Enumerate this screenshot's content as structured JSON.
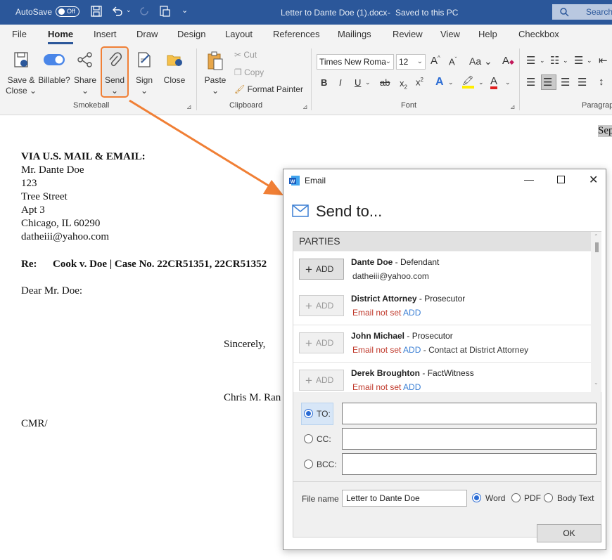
{
  "titlebar": {
    "autosave_label": "AutoSave",
    "autosave_state": "Off",
    "document_title": "Letter to Dante Doe (1).docx",
    "save_status": "Saved to this PC",
    "search_label": "Search"
  },
  "tabs": [
    "File",
    "Home",
    "Insert",
    "Draw",
    "Design",
    "Layout",
    "References",
    "Mailings",
    "Review",
    "View",
    "Help",
    "Checkbox"
  ],
  "ribbon": {
    "smokeball": {
      "group_label": "Smokeball",
      "save_close": [
        "Save &",
        "Close"
      ],
      "billable": "Billable?",
      "share": "Share",
      "send": "Send",
      "sign": "Sign",
      "close": "Close"
    },
    "clipboard": {
      "group_label": "Clipboard",
      "paste": "Paste",
      "cut": "Cut",
      "copy": "Copy",
      "format_painter": "Format Painter"
    },
    "font": {
      "group_label": "Font",
      "font_name": "Times New Roma",
      "font_size": "12"
    },
    "paragraph": {
      "group_label": "Paragrap"
    }
  },
  "document": {
    "date_fragment": "Sep",
    "lines": [
      "VIA U.S. MAIL & EMAIL:",
      "Mr. Dante Doe",
      "123",
      "Tree Street",
      "Apt 3",
      "Chicago, IL 60290",
      "datheiii@yahoo.com"
    ],
    "re_label": "Re:",
    "re_text": "Cook v. Doe | Case No. 22CR51351, 22CR51352",
    "salutation": "Dear Mr. Doe:",
    "closing": "Sincerely,",
    "signer": "Chris M. Ran",
    "initials": "CMR/"
  },
  "dialog": {
    "window_title": "Email",
    "heading": "Send to...",
    "parties_header": "PARTIES",
    "add_label": "ADD",
    "parties": [
      {
        "name": "Dante Doe",
        "role": "Defendant",
        "email": "datheiii@yahoo.com",
        "email_missing": false,
        "add_link": "",
        "contact": ""
      },
      {
        "name": "District Attorney",
        "role": "Prosecutor",
        "email": "Email not set",
        "email_missing": true,
        "add_link": "ADD",
        "contact": ""
      },
      {
        "name": "John Michael",
        "role": "Prosecutor",
        "email": "Email not set",
        "email_missing": true,
        "add_link": "ADD",
        "contact": "Contact at District Attorney"
      },
      {
        "name": "Derek Broughton",
        "role": "FactWitness",
        "email": "Email not set",
        "email_missing": true,
        "add_link": "ADD",
        "contact": ""
      }
    ],
    "recipients": {
      "to_label": "TO:",
      "cc_label": "CC:",
      "bcc_label": "BCC:",
      "selected": "TO",
      "to_value": "",
      "cc_value": "",
      "bcc_value": ""
    },
    "file": {
      "label": "File name",
      "value": "Letter to Dante Doe",
      "formats": [
        "Word",
        "PDF",
        "Body Text"
      ],
      "selected_format": "Word"
    },
    "ok_label": "OK"
  },
  "colors": {
    "titlebar": "#2b579a",
    "annotation_arrow": "#f07f35",
    "error_text": "#c0392b",
    "link_text": "#3b7fd4"
  }
}
